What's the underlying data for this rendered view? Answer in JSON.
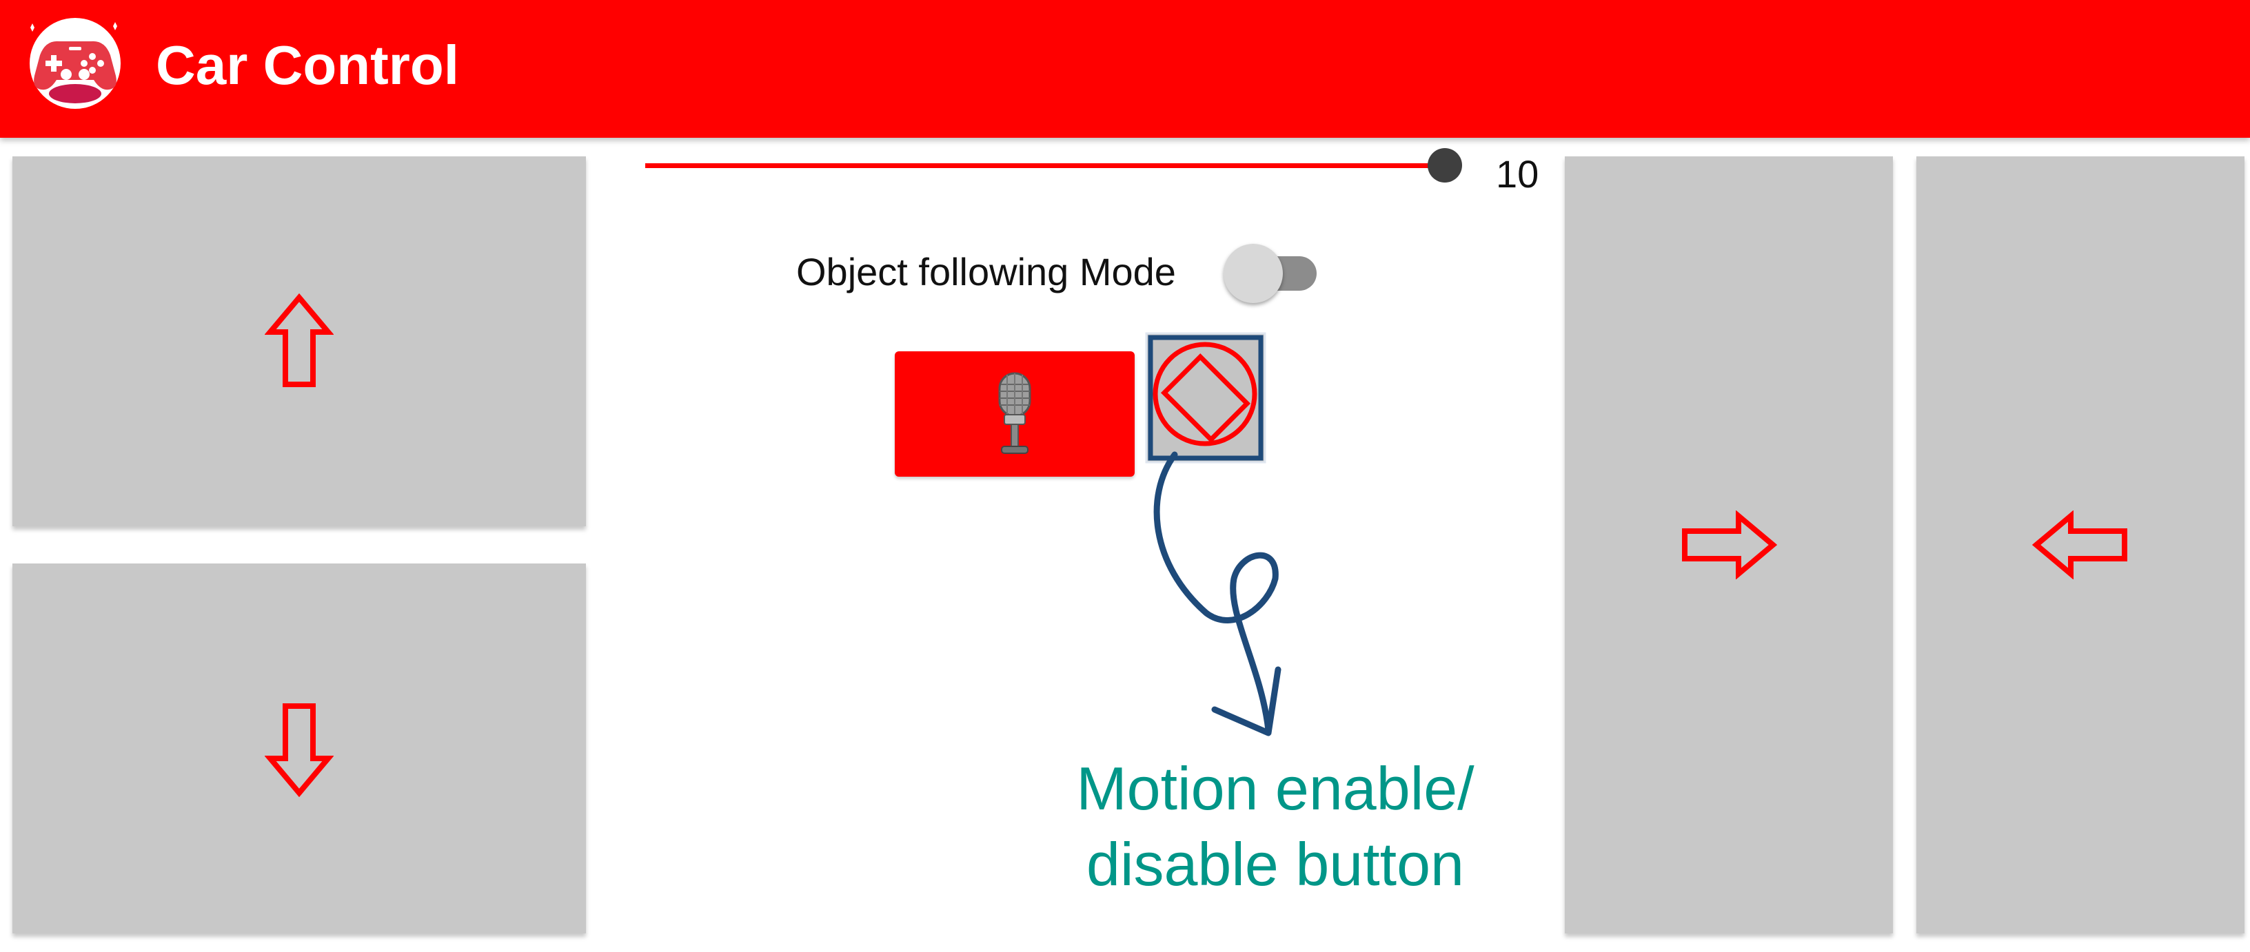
{
  "appbar": {
    "title": "Car Control",
    "icon": "gamepad-icon",
    "color": "#ff0000"
  },
  "pads": {
    "forward_icon": "arrow-up-icon",
    "backward_icon": "arrow-down-icon",
    "right_icon": "arrow-right-icon",
    "left_icon": "arrow-left-icon",
    "arrow_color": "#ff0000",
    "pad_color": "#c8c8c8"
  },
  "speed": {
    "value": "10",
    "max": 10,
    "fraction": 1.0
  },
  "mode": {
    "label": "Object following Mode",
    "enabled": false
  },
  "controls": {
    "mic_icon": "microphone-icon",
    "motion_icon": "screen-rotation-icon"
  },
  "annotation": {
    "line1": "Motion enable/",
    "line2": "disable button",
    "color": "#009688"
  }
}
